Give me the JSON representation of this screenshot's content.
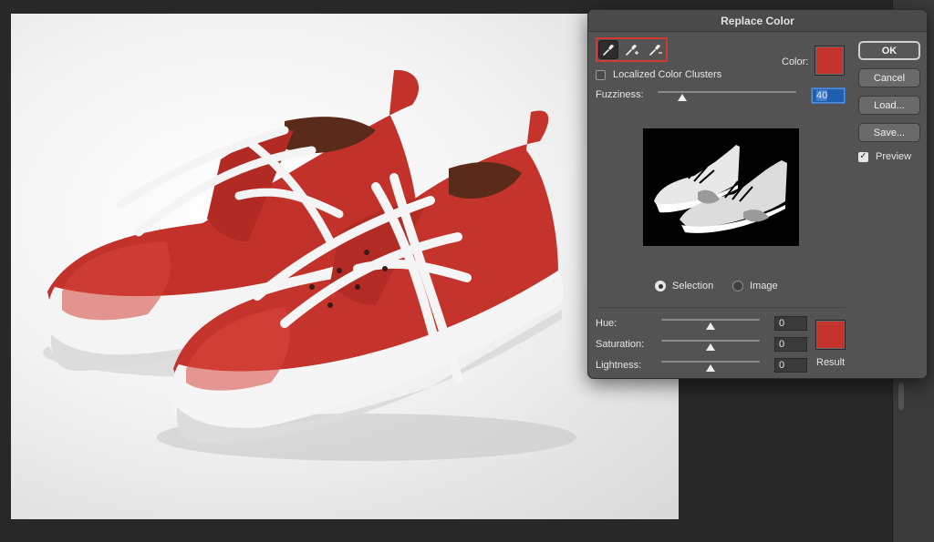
{
  "dialog": {
    "title": "Replace Color",
    "tools": [
      "eyedropper-icon",
      "eyedropper-plus-icon",
      "eyedropper-minus-icon"
    ],
    "localized_color_clusters": {
      "label": "Localized Color Clusters",
      "checked": false
    },
    "color": {
      "label": "Color:",
      "value": "#c5342c"
    },
    "fuzziness": {
      "label": "Fuzziness:",
      "value": "40",
      "level": 0.18
    },
    "view_options": {
      "selection_label": "Selection",
      "image_label": "Image",
      "selected": "Selection"
    },
    "replacement": {
      "hue": {
        "label": "Hue:",
        "value": "0",
        "level": 0.5
      },
      "saturation": {
        "label": "Saturation:",
        "value": "0",
        "level": 0.5
      },
      "lightness": {
        "label": "Lightness:",
        "value": "0",
        "level": 0.5
      },
      "result_label": "Result",
      "result_color": "#c5342c"
    },
    "buttons": {
      "ok": "OK",
      "cancel": "Cancel",
      "load": "Load...",
      "save": "Save..."
    },
    "preview": {
      "label": "Preview",
      "checked": true
    }
  },
  "colors": {
    "accent_highlight": "#d13a2f",
    "dialog_bg": "#535353",
    "sneaker_red": "#c5342c"
  }
}
